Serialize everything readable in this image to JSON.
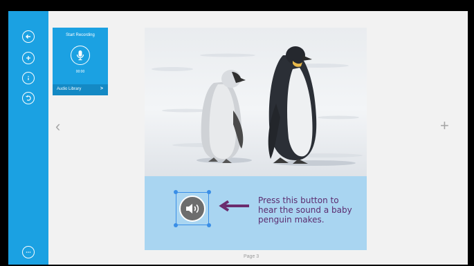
{
  "sidebar": {
    "buttons": [
      {
        "name": "back-icon"
      },
      {
        "name": "add-icon"
      },
      {
        "name": "info-icon"
      },
      {
        "name": "undo-icon"
      },
      {
        "name": "more-icon"
      }
    ]
  },
  "recording": {
    "title": "Start Recording",
    "time": "00:00",
    "library_label": "Audio Library",
    "library_chevron": ">"
  },
  "navigation": {
    "prev_symbol": "‹",
    "add_symbol": "+"
  },
  "page": {
    "caption_lines": [
      "Press this button to",
      "hear the sound a baby",
      "penguin makes."
    ],
    "label": "Page 3"
  },
  "colors": {
    "accent": "#1ba1e2",
    "caption_bg": "#a9d5f1",
    "caption_text": "#5b2c6f",
    "selection": "#3a8ee6"
  }
}
